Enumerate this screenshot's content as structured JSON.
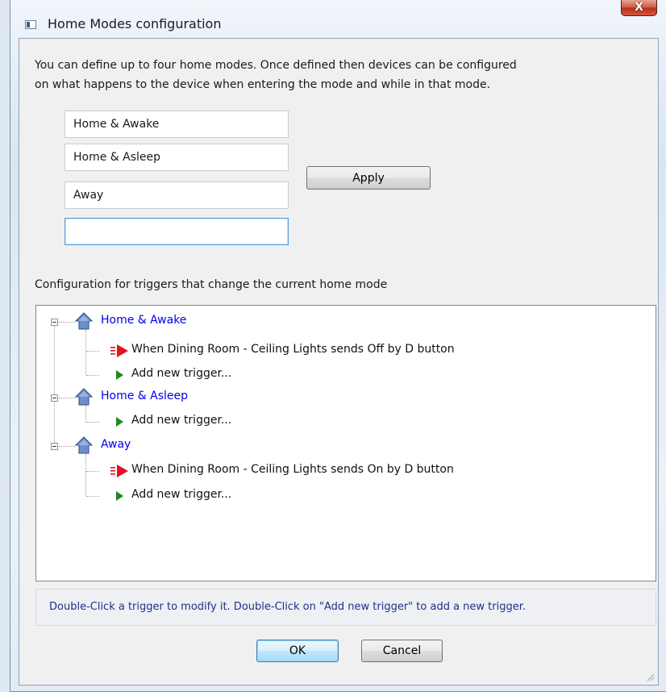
{
  "window": {
    "title": "Home Modes configuration",
    "close_glyph": "X",
    "icon": "app-window-icon"
  },
  "intro": {
    "line1": "You can define up to four home modes. Once defined then devices can be configured",
    "line2": "on what happens to the device when entering the mode and while in that mode."
  },
  "modes": [
    {
      "value": "Home & Awake"
    },
    {
      "value": "Home & Asleep"
    },
    {
      "value": "Away"
    },
    {
      "value": ""
    }
  ],
  "buttons": {
    "apply": "Apply",
    "ok": "OK",
    "cancel": "Cancel"
  },
  "triggers_section": {
    "label": "Configuration for triggers that change the current home mode"
  },
  "tree": {
    "nodes": [
      {
        "label": "Home & Awake",
        "icon": "house-icon",
        "children": [
          {
            "label": "When Dining Room - Ceiling Lights sends Off by D button",
            "icon": "red-arrow-icon"
          },
          {
            "label": "Add new trigger...",
            "icon": "green-triangle-icon"
          }
        ]
      },
      {
        "label": "Home & Asleep",
        "icon": "house-icon",
        "children": [
          {
            "label": "Add new trigger...",
            "icon": "green-triangle-icon"
          }
        ]
      },
      {
        "label": "Away",
        "icon": "house-icon",
        "children": [
          {
            "label": "When Dining Room - Ceiling Lights sends On by D button",
            "icon": "red-arrow-icon"
          },
          {
            "label": "Add new trigger...",
            "icon": "green-triangle-icon"
          }
        ]
      }
    ]
  },
  "hint": "Double-Click a trigger to modify it.  Double-Click on \"Add new trigger\" to add a new trigger.",
  "colors": {
    "mode_link": "#0000ee",
    "hint_text": "#20308a",
    "close_button": "#c7412a",
    "trigger_arrow": "#e0141e",
    "add_arrow": "#1f8a1f",
    "house": "#6b8fc8"
  }
}
